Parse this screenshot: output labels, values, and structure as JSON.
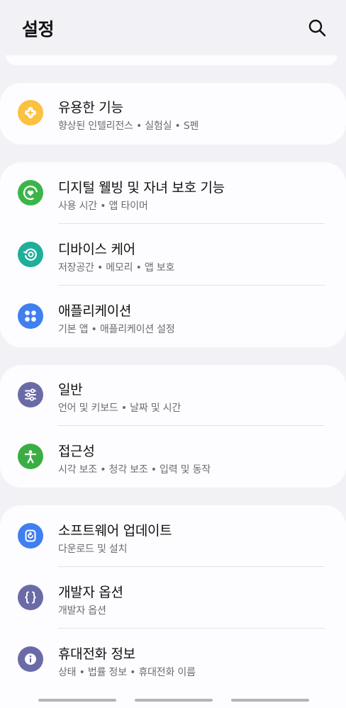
{
  "header": {
    "title": "설정"
  },
  "sections": [
    {
      "items": [
        {
          "title": "유용한 기능",
          "subtitle": "향상된 인텔리전스  •  실험실  •  S펜",
          "icon": "plus-flower-icon",
          "color": "#fbc13f"
        }
      ]
    },
    {
      "items": [
        {
          "title": "디지털 웰빙 및 자녀 보호 기능",
          "subtitle": "사용 시간  •  앱 타이머",
          "icon": "wellbeing-heart-icon",
          "color": "#3bb54a"
        },
        {
          "title": "디바이스 케어",
          "subtitle": "저장공간  •  메모리  •  앱 보호",
          "icon": "device-care-icon",
          "color": "#1fae9a"
        },
        {
          "title": "애플리케이션",
          "subtitle": "기본 앱  •  애플리케이션 설정",
          "icon": "apps-grid-icon",
          "color": "#3f7ff0"
        }
      ]
    },
    {
      "items": [
        {
          "title": "일반",
          "subtitle": "언어 및 키보드  •  날짜 및 시간",
          "icon": "sliders-icon",
          "color": "#6a6ba6"
        },
        {
          "title": "접근성",
          "subtitle": "시각 보조  •  청각 보조  •  입력 및 동작",
          "icon": "accessibility-icon",
          "color": "#3bae43"
        }
      ]
    },
    {
      "items": [
        {
          "title": "소프트웨어 업데이트",
          "subtitle": "다운로드 및 설치",
          "icon": "update-icon",
          "color": "#3f7ff0"
        },
        {
          "title": "개발자 옵션",
          "subtitle": "개발자 옵션",
          "icon": "braces-icon",
          "color": "#6a6ba6"
        },
        {
          "title": "휴대전화 정보",
          "subtitle": "상태  •  법률 정보  •  휴대전화 이름",
          "icon": "info-icon",
          "color": "#6a6ba6"
        }
      ]
    }
  ]
}
